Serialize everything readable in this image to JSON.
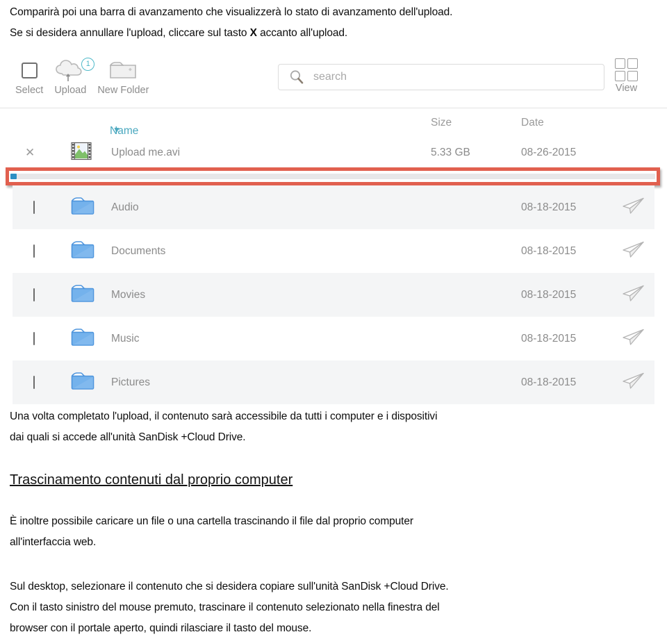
{
  "document": {
    "intro_lines": [
      "Comparirà poi una barra di avanzamento che visualizzerà lo stato di avanzamento dell'upload.",
      "Se si desidera annullare l'upload, cliccare sul tasto ",
      "X",
      " accanto all'upload."
    ],
    "para_after_shot": [
      "Una volta completato l'upload, il contenuto sarà accessibile da tutti i computer e i dispositivi",
      "dai quali si accede all'unità SanDisk +Cloud Drive."
    ],
    "section_heading": "Trascinamento contenuti dal proprio computer",
    "para_drag": [
      "È inoltre possibile caricare un file o una cartella trascinando il file dal proprio computer",
      "all'interfaccia web."
    ],
    "para_desktop": [
      "Sul desktop, selezionare il contenuto che si desidera copiare sull'unità SanDisk +Cloud Drive.",
      "Con il tasto sinistro del mouse premuto, trascinare il contenuto selezionato nella finestra del",
      "browser con il portale aperto, quindi rilasciare il tasto del mouse."
    ]
  },
  "app": {
    "toolbar": {
      "select_label": "Select",
      "upload_label": "Upload",
      "upload_badge": "1",
      "new_folder_label": "New Folder",
      "select_icon": "checkbox-icon",
      "upload_icon": "cloud-upload-icon",
      "new_folder_icon": "new-folder-icon"
    },
    "search": {
      "placeholder": "search",
      "value": "",
      "icon": "magnifier-icon"
    },
    "view": {
      "label": "View",
      "icon": "grid-view-icon"
    },
    "columns": {
      "name": "Name",
      "name_sort_caret": "▼",
      "size": "Size",
      "date": "Date"
    },
    "upload_item": {
      "cancel_glyph": "✕",
      "icon": "video-file-icon",
      "name": "Upload me.avi",
      "size": "5.33 GB",
      "date": "08-26-2015",
      "progress_percent": 1
    },
    "rows": [
      {
        "name": "Audio",
        "size": "",
        "date": "08-18-2015",
        "icon": "folder-icon",
        "share_icon": "paper-plane-icon"
      },
      {
        "name": "Documents",
        "size": "",
        "date": "08-18-2015",
        "icon": "folder-icon",
        "share_icon": "paper-plane-icon"
      },
      {
        "name": "Movies",
        "size": "",
        "date": "08-18-2015",
        "icon": "folder-icon",
        "share_icon": "paper-plane-icon"
      },
      {
        "name": "Music",
        "size": "",
        "date": "08-18-2015",
        "icon": "folder-icon",
        "share_icon": "paper-plane-icon"
      },
      {
        "name": "Pictures",
        "size": "",
        "date": "08-18-2015",
        "icon": "folder-icon",
        "share_icon": "paper-plane-icon"
      }
    ],
    "colors": {
      "accent_teal": "#4aa8bf",
      "folder_blue": "#5ba4e5",
      "annotation_red": "#e1604f",
      "progress_blue": "#2d8fc4"
    }
  }
}
